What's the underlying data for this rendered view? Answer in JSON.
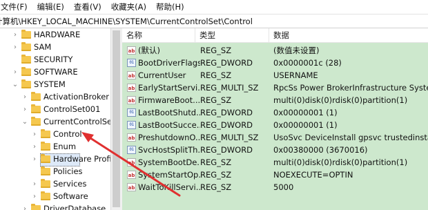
{
  "menu": [
    "文件(F)",
    "编辑(E)",
    "查看(V)",
    "收藏夹(A)",
    "帮助(H)"
  ],
  "address": "计算机\\HKEY_LOCAL_MACHINE\\SYSTEM\\CurrentControlSet\\Control",
  "tree": [
    {
      "label": "HARDWARE",
      "chevron": "›"
    },
    {
      "label": "SAM",
      "chevron": "›"
    },
    {
      "label": "SECURITY",
      "chevron": ""
    },
    {
      "label": "SOFTWARE",
      "chevron": "›"
    },
    {
      "label": "SYSTEM",
      "chevron": "⌄"
    },
    {
      "label": "ActivationBroker",
      "chevron": "›"
    },
    {
      "label": "ControlSet001",
      "chevron": "›"
    },
    {
      "label": "CurrentControlSet",
      "chevron": "⌄"
    },
    {
      "label": "Control",
      "chevron": "›",
      "selected": true
    },
    {
      "label": "Enum",
      "chevron": "›"
    },
    {
      "label": "Hardware Profil",
      "chevron": "›"
    },
    {
      "label": "Policies",
      "chevron": ""
    },
    {
      "label": "Services",
      "chevron": "›"
    },
    {
      "label": "Software",
      "chevron": "›"
    },
    {
      "label": "DriverDatabase",
      "chevron": "›"
    }
  ],
  "columns": {
    "name": "名称",
    "type": "类型",
    "data": "数据"
  },
  "values": [
    {
      "icon": "ab",
      "name": "(默认)",
      "type": "REG_SZ",
      "data": "(数值未设置)"
    },
    {
      "icon": "bin",
      "name": "BootDriverFlags",
      "type": "REG_DWORD",
      "data": "0x0000001c (28)"
    },
    {
      "icon": "ab",
      "name": "CurrentUser",
      "type": "REG_SZ",
      "data": "USERNAME"
    },
    {
      "icon": "ab",
      "name": "EarlyStartServi...",
      "type": "REG_MULTI_SZ",
      "data": "RpcSs Power BrokerInfrastructure SystemEv"
    },
    {
      "icon": "ab",
      "name": "FirmwareBoot...",
      "type": "REG_SZ",
      "data": "multi(0)disk(0)rdisk(0)partition(1)"
    },
    {
      "icon": "bin",
      "name": "LastBootShutd...",
      "type": "REG_DWORD",
      "data": "0x00000001 (1)"
    },
    {
      "icon": "bin",
      "name": "LastBootSucce...",
      "type": "REG_DWORD",
      "data": "0x00000001 (1)"
    },
    {
      "icon": "ab",
      "name": "PreshutdownO...",
      "type": "REG_MULTI_SZ",
      "data": "UsoSvc DeviceInstall gpsvc trustedinstaller"
    },
    {
      "icon": "bin",
      "name": "SvcHostSplitTh...",
      "type": "REG_DWORD",
      "data": "0x00380000 (3670016)"
    },
    {
      "icon": "ab",
      "name": "SystemBootDe...",
      "type": "REG_SZ",
      "data": "multi(0)disk(0)rdisk(0)partition(1)"
    },
    {
      "icon": "ab",
      "name": "SystemStartOp...",
      "type": "REG_SZ",
      "data": " NOEXECUTE=OPTIN"
    },
    {
      "icon": "ab",
      "name": "WaitToKillServi...",
      "type": "REG_SZ",
      "data": "5000"
    }
  ],
  "colors": {
    "value_pane_bg": "#cde8cd",
    "annotation_arrow": "#e03030",
    "folder": "#f5c84f"
  }
}
